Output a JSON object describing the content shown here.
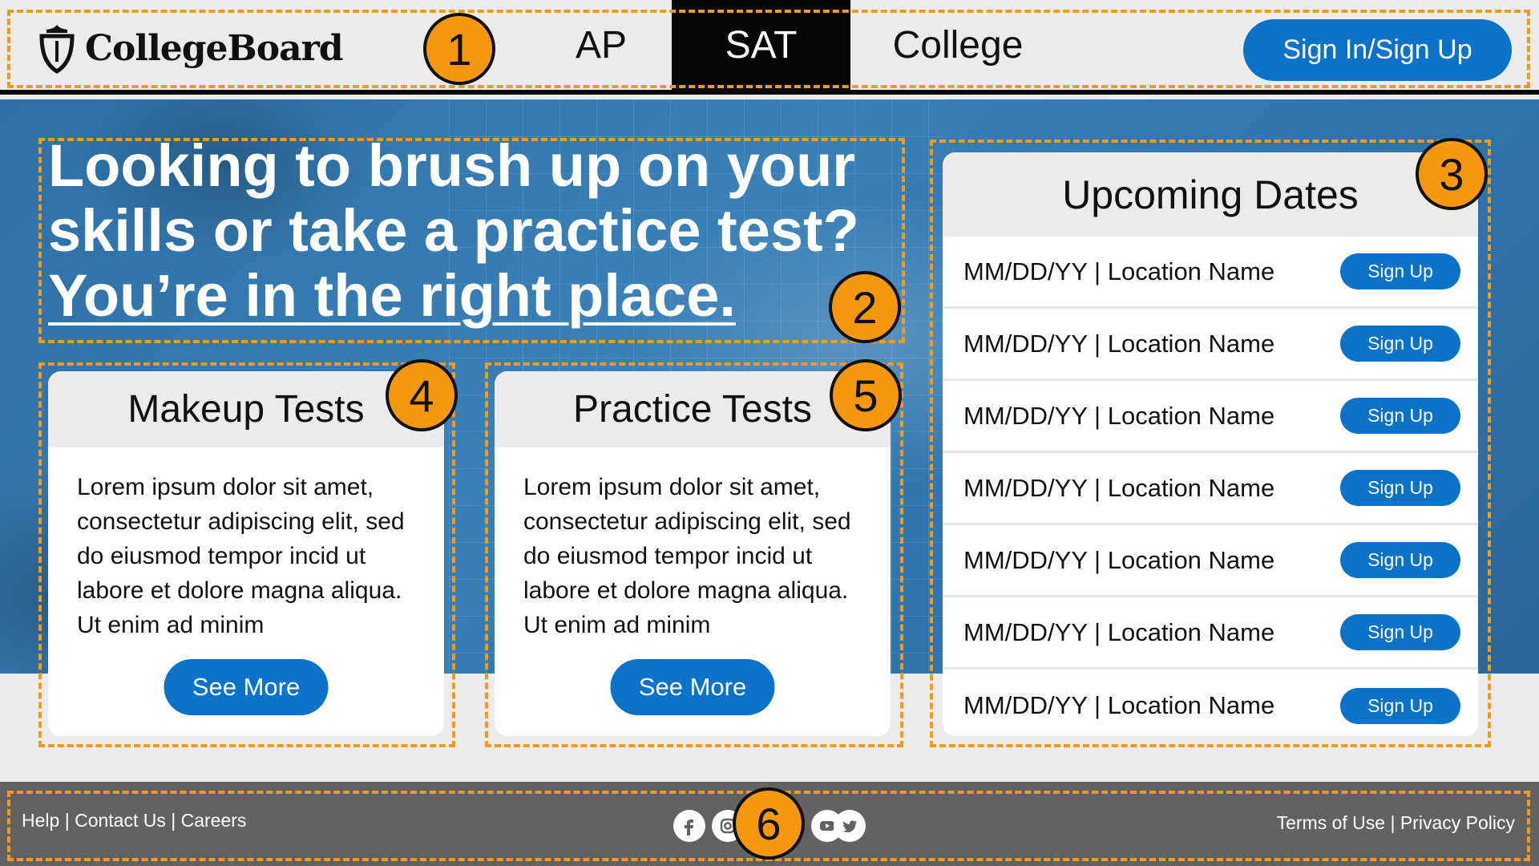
{
  "header": {
    "logo_text": "CollegeBoard",
    "nav": [
      "AP",
      "SAT",
      "College"
    ],
    "active_nav": "SAT",
    "signin_label": "Sign In/Sign Up"
  },
  "hero": {
    "line1": "Looking to brush up on your",
    "line2": "skills or take a practice test?",
    "link": "You’re in the right place."
  },
  "cards": [
    {
      "title": "Makeup Tests",
      "body": "Lorem ipsum dolor sit amet, consectetur adipiscing elit, sed do eiusmod tempor incid ut labore et dolore magna aliqua. Ut enim ad minim",
      "button": "See More"
    },
    {
      "title": "Practice Tests",
      "body": "Lorem ipsum dolor sit amet, consectetur adipiscing elit, sed do eiusmod tempor incid ut labore et dolore magna aliqua. Ut enim ad minim",
      "button": "See More"
    }
  ],
  "upcoming": {
    "title": "Upcoming Dates",
    "rows": [
      {
        "text": "MM/DD/YY | Location Name",
        "button": "Sign Up"
      },
      {
        "text": "MM/DD/YY | Location Name",
        "button": "Sign Up"
      },
      {
        "text": "MM/DD/YY | Location Name",
        "button": "Sign Up"
      },
      {
        "text": "MM/DD/YY | Location Name",
        "button": "Sign Up"
      },
      {
        "text": "MM/DD/YY | Location Name",
        "button": "Sign Up"
      },
      {
        "text": "MM/DD/YY | Location Name",
        "button": "Sign Up"
      },
      {
        "text": "MM/DD/YY | Location Name",
        "button": "Sign Up"
      }
    ]
  },
  "footer": {
    "help": "Help",
    "contact": "Contact Us",
    "careers": "Careers",
    "separator": "|",
    "terms": "Terms of Use",
    "privacy": "Privacy Policy",
    "social_icons": [
      "facebook-icon",
      "instagram-icon",
      "youtube-icon",
      "twitter-icon"
    ]
  },
  "annotations": [
    "1",
    "2",
    "3",
    "4",
    "5",
    "6"
  ],
  "colors": {
    "accent": "#0a72c8",
    "annotation": "#f5980e",
    "footer": "#626262",
    "background": "#ebebeb"
  }
}
